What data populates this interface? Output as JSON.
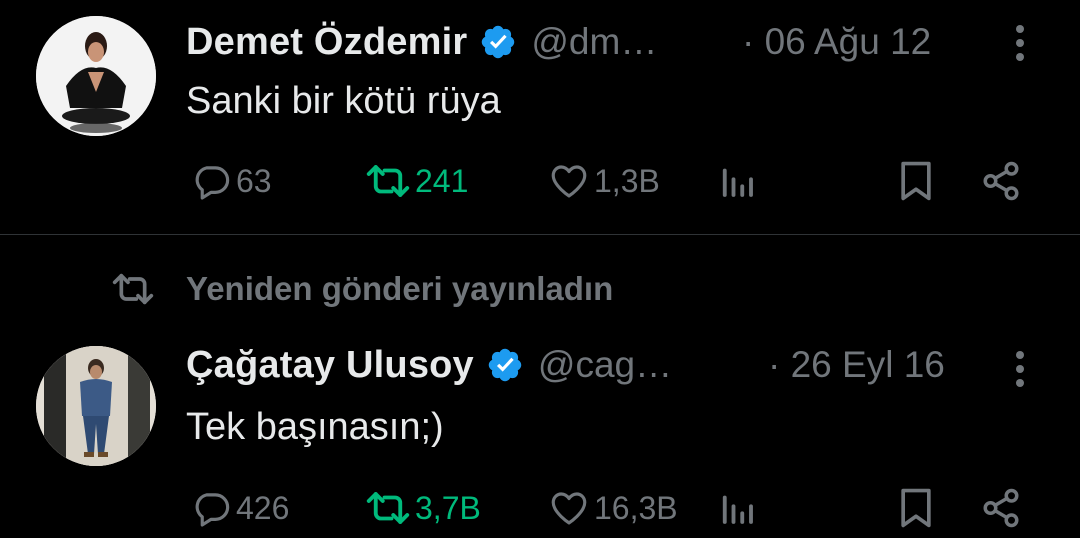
{
  "tweets": [
    {
      "author": "Demet Özdemir",
      "handle": "@dm…",
      "date": "· 06 Ağu 12",
      "text": "Sanki bir kötü rüya",
      "stats": {
        "replies": "63",
        "retweets": "241",
        "likes": "1,3B"
      }
    },
    {
      "author": "Çağatay Ulusoy",
      "handle": "@cag…",
      "date": "· 26 Eyl 16",
      "text": "Tek başınasın;)",
      "stats": {
        "replies": "426",
        "retweets": "3,7B",
        "likes": "16,3B"
      }
    }
  ],
  "social_context": "Yeniden gönderi yayınladın",
  "colors": {
    "background": "#000000",
    "primary_text": "#e7e9ea",
    "secondary_text": "#71767b",
    "verified_blue": "#1d9bf0",
    "retweet_green": "#00ba7c",
    "divider": "#2f3336"
  },
  "icons": [
    "verified-badge-icon",
    "more-icon",
    "reply-icon",
    "retweet-icon",
    "like-icon",
    "views-icon",
    "bookmark-icon",
    "share-icon"
  ]
}
